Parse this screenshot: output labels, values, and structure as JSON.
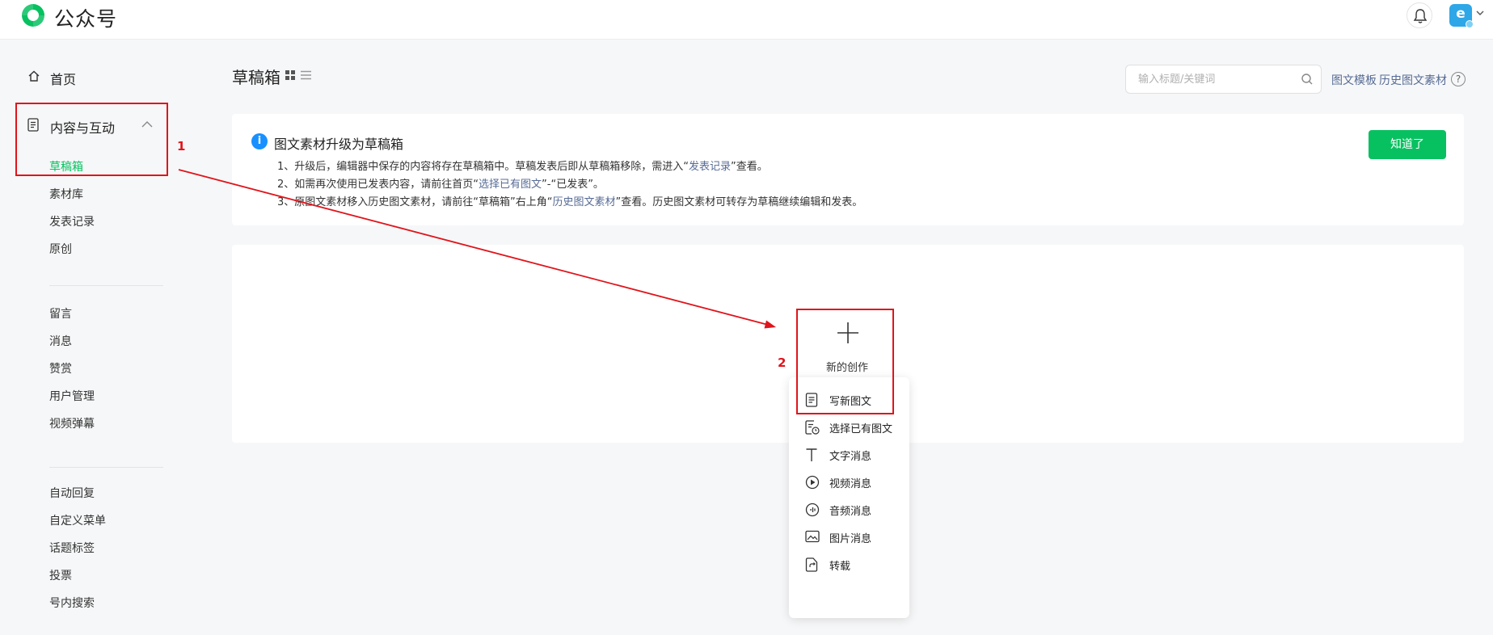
{
  "app": {
    "brand": "公众号"
  },
  "sidebar": {
    "home": "首页",
    "group": "内容与互动",
    "items": [
      {
        "label": "草稿箱",
        "active": true
      },
      {
        "label": "素材库"
      },
      {
        "label": "发表记录"
      },
      {
        "label": "原创"
      },
      {
        "label": "留言"
      },
      {
        "label": "消息"
      },
      {
        "label": "赞赏"
      },
      {
        "label": "用户管理"
      },
      {
        "label": "视频弹幕"
      },
      {
        "label": "自动回复"
      },
      {
        "label": "自定义菜单"
      },
      {
        "label": "话题标签"
      },
      {
        "label": "投票"
      },
      {
        "label": "号内搜索"
      }
    ]
  },
  "header": {
    "title": "草稿箱",
    "search_placeholder": "输入标题/关键词",
    "links": [
      "图文模板",
      "历史图文素材"
    ]
  },
  "notice": {
    "title": "图文素材升级为草稿箱",
    "line1_a": "1、升级后，编辑器中保存的内容将存在草稿箱中。草稿发表后即从草稿箱移除，需进入“",
    "line1_link": "发表记录",
    "line1_b": "”查看。",
    "line2_a": "2、如需再次使用已发表内容，请前往首页“",
    "line2_link": "选择已有图文",
    "line2_b": "”-“已发表”。",
    "line3_a": "3、原图文素材移入历史图文素材，请前往“草稿箱”右上角“",
    "line3_link": "历史图文素材",
    "line3_b": "”查看。历史图文素材可转存为草稿继续编辑和发表。",
    "button": "知道了"
  },
  "create": {
    "label": "新的创作",
    "menu": [
      {
        "label": "写新图文",
        "icon": "article-icon"
      },
      {
        "label": "选择已有图文",
        "icon": "existing-article-icon"
      },
      {
        "label": "文字消息",
        "icon": "text-icon"
      },
      {
        "label": "视频消息",
        "icon": "video-icon"
      },
      {
        "label": "音频消息",
        "icon": "audio-icon"
      },
      {
        "label": "图片消息",
        "icon": "image-icon"
      },
      {
        "label": "转载",
        "icon": "repost-icon"
      }
    ]
  },
  "annotations": {
    "step1": "1",
    "step2": "2"
  },
  "colors": {
    "accent": "#07c160",
    "link": "#576b95",
    "annotation": "#e0141b",
    "info": "#1890ff"
  }
}
